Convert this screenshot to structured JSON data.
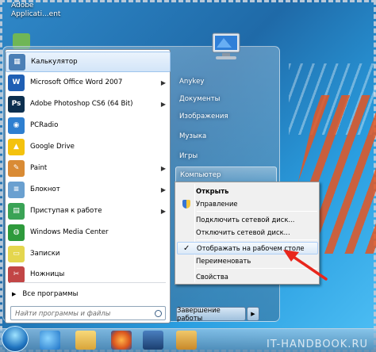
{
  "desktop": {
    "top_text_line1": "Adobe",
    "top_text_line2": "Applicati...ent"
  },
  "start_menu": {
    "pinned_programs": [
      {
        "label": "Калькулятор",
        "icon": "calculator-icon",
        "color": "#4b7fb6",
        "glyph": "▦",
        "has_arrow": false
      },
      {
        "label": "Microsoft Office Word 2007",
        "icon": "word-icon",
        "color": "#1f5fb4",
        "glyph": "W",
        "has_arrow": true
      },
      {
        "label": "Adobe Photoshop CS6 (64 Bit)",
        "icon": "photoshop-icon",
        "color": "#0c2f4f",
        "glyph": "Ps",
        "has_arrow": true
      },
      {
        "label": "PCRadio",
        "icon": "pcradio-icon",
        "color": "#2e7fd0",
        "glyph": "◉",
        "has_arrow": false
      },
      {
        "label": "Google Drive",
        "icon": "google-drive-icon",
        "color": "#f4c20d",
        "glyph": "▲",
        "has_arrow": false
      },
      {
        "label": "Paint",
        "icon": "paint-icon",
        "color": "#d98b35",
        "glyph": "✎",
        "has_arrow": true
      },
      {
        "label": "Блокнот",
        "icon": "notepad-icon",
        "color": "#6aa0d0",
        "glyph": "≡",
        "has_arrow": true
      },
      {
        "label": "Приступая к работе",
        "icon": "getting-started-icon",
        "color": "#3aa356",
        "glyph": "▤",
        "has_arrow": true
      },
      {
        "label": "Windows Media Center",
        "icon": "media-center-icon",
        "color": "#2e9a3c",
        "glyph": "◍",
        "has_arrow": false
      },
      {
        "label": "Записки",
        "icon": "sticky-notes-icon",
        "color": "#e4d64e",
        "glyph": "▭",
        "has_arrow": false
      },
      {
        "label": "Ножницы",
        "icon": "snipping-tool-icon",
        "color": "#c24646",
        "glyph": "✂",
        "has_arrow": false
      }
    ],
    "all_programs_label": "Все программы",
    "search_placeholder": "Найти программы и файлы",
    "right_items": [
      {
        "label": "Anykey"
      },
      {
        "label": "Документы"
      },
      {
        "label": "Изображения"
      },
      {
        "label": "Музыка"
      },
      {
        "label": "Игры"
      },
      {
        "label": "Компьютер"
      }
    ],
    "shutdown_label": "Завершение работы"
  },
  "context_menu": {
    "items": [
      {
        "label": "Открыть",
        "bold": true
      },
      {
        "label": "Управление",
        "shield": true
      },
      {
        "label": "Подключить сетевой диск..."
      },
      {
        "label": "Отключить сетевой диск..."
      },
      {
        "label": "Отображать на рабочем столе",
        "checked": true,
        "highlighted": true
      },
      {
        "label": "Переименовать"
      },
      {
        "label": "Свойства"
      }
    ]
  },
  "watermark": "IT-HANDBOOK.RU",
  "colors": {
    "accent": "#1f6aa8",
    "arrow": "#e8261c"
  }
}
